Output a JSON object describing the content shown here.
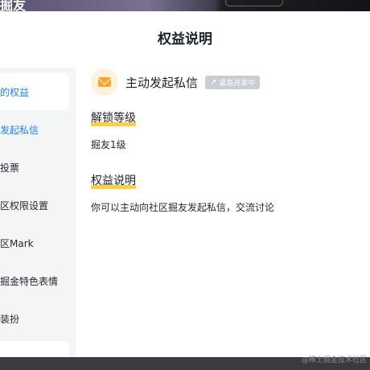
{
  "background": {
    "title_fragment": "掘友"
  },
  "modal": {
    "title": "权益说明"
  },
  "sidebar": {
    "items": [
      {
        "label": "的权益",
        "state": "active"
      },
      {
        "label": "发起私信",
        "state": "link"
      },
      {
        "label": "投票",
        "state": "normal"
      },
      {
        "label": "区权限设置",
        "state": "normal"
      },
      {
        "label": "区Mark",
        "state": "normal"
      },
      {
        "label": "掘金特色表情",
        "state": "normal"
      },
      {
        "label": "装扮",
        "state": "normal"
      }
    ]
  },
  "content": {
    "icon": "envelope-icon",
    "permission_name": "主动发起私信",
    "badge": {
      "icon": "arrow-up-right-icon",
      "label": "紧急开发中"
    },
    "unlock": {
      "title": "解锁等级",
      "text": "掘友1级"
    },
    "description": {
      "title": "权益说明",
      "text": "你可以主动向社区掘友发起私信，交流讨论"
    }
  },
  "watermark": "@稀土掘金技术社区",
  "colors": {
    "accent": "#1e80ff",
    "highlight": "#ffce42",
    "icon_orange": "#ffa52e",
    "badge_gray": "#c9cdd4"
  }
}
